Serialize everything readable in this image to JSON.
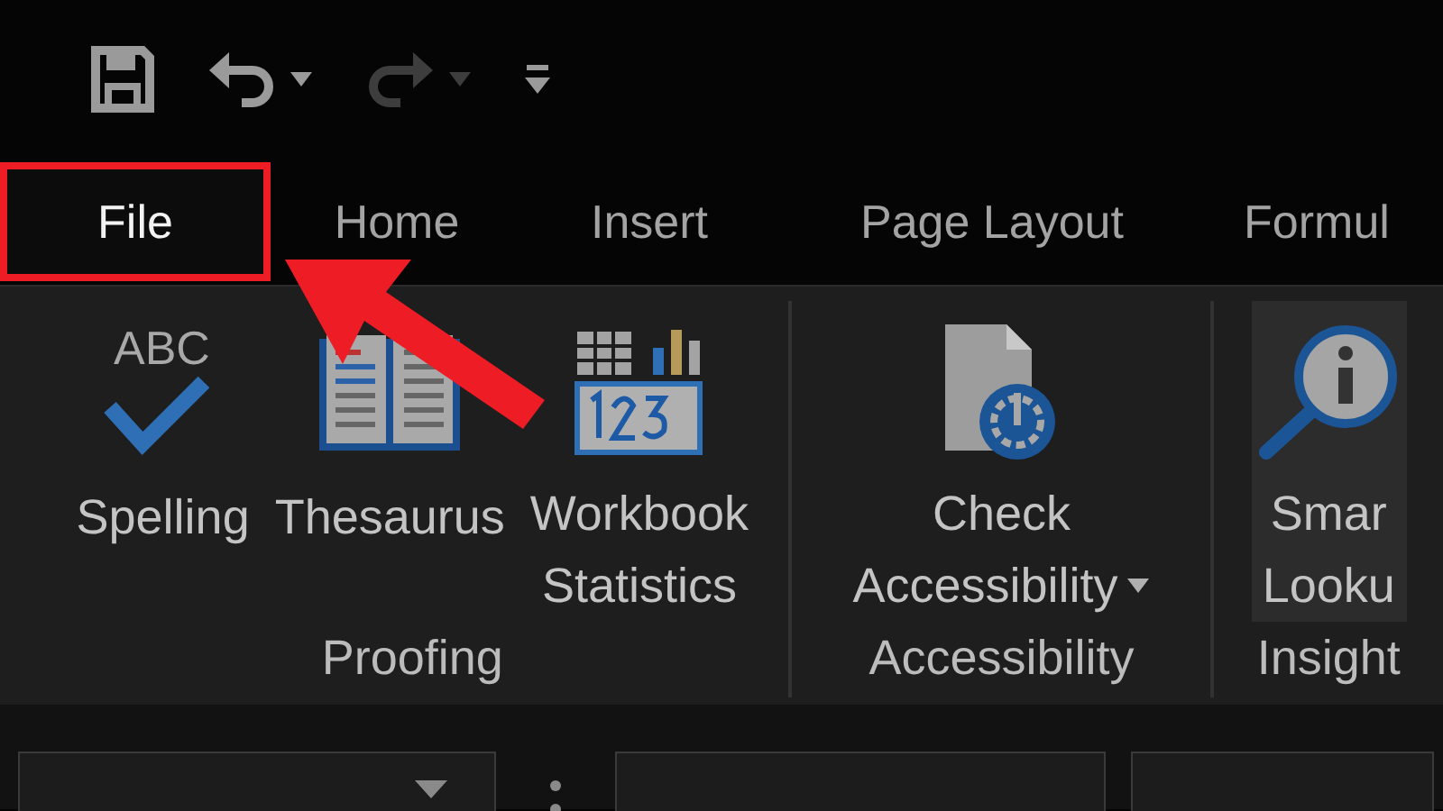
{
  "quick_access": [
    {
      "kind": "save",
      "disabled": false
    },
    {
      "kind": "undo",
      "disabled": false,
      "dropdown": true
    },
    {
      "kind": "redo",
      "disabled": true,
      "dropdown": true
    },
    {
      "kind": "customize",
      "disabled": false
    }
  ],
  "tabs": [
    {
      "label": "File",
      "selected": true,
      "highlighted": true
    },
    {
      "label": "Home",
      "selected": false,
      "highlighted": false
    },
    {
      "label": "Insert",
      "selected": false,
      "highlighted": false
    },
    {
      "label": "Page Layout",
      "selected": false,
      "highlighted": false
    },
    {
      "label": "Formul",
      "selected": false,
      "highlighted": false
    }
  ],
  "groups": [
    {
      "label": "Proofing",
      "buttons": [
        {
          "kind": "spelling",
          "icon_text": "ABC",
          "lines": [
            "Spelling"
          ],
          "dropdown": false,
          "highlighted": false
        },
        {
          "kind": "thesaurus",
          "lines": [
            "Thesaurus"
          ],
          "dropdown": false,
          "highlighted": false
        },
        {
          "kind": "statistics",
          "lines": [
            "Workbook",
            "Statistics"
          ],
          "dropdown": false,
          "highlighted": false
        }
      ]
    },
    {
      "label": "Accessibility",
      "buttons": [
        {
          "kind": "accessibility",
          "lines": [
            "Check",
            "Accessibility"
          ],
          "dropdown": true,
          "highlighted": false
        }
      ]
    },
    {
      "label": "Insight",
      "buttons": [
        {
          "kind": "lookup",
          "lines": [
            "Smar",
            "Looku"
          ],
          "dropdown": false,
          "highlighted": true
        }
      ]
    }
  ]
}
